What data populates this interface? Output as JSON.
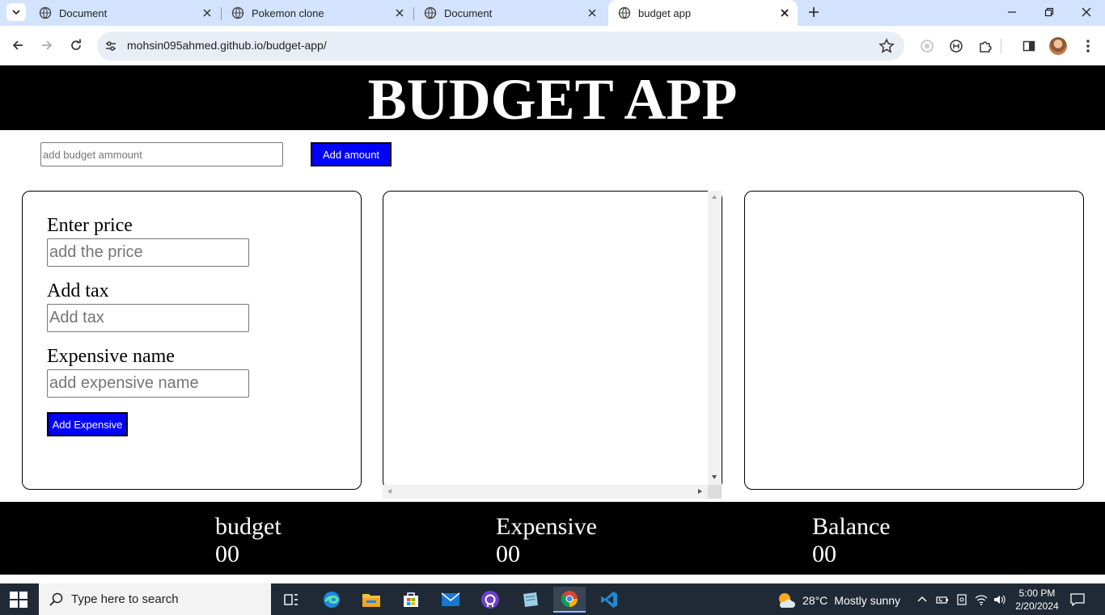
{
  "browser": {
    "tabs": [
      {
        "title": "Document",
        "active": false
      },
      {
        "title": "Pokemon clone",
        "active": false
      },
      {
        "title": "Document",
        "active": false
      },
      {
        "title": "budget app",
        "active": true
      }
    ],
    "url": "mohsin095ahmed.github.io/budget-app/"
  },
  "app": {
    "header_title": "BUDGET APP",
    "budget_input_placeholder": "add budget ammount",
    "add_amount_label": "Add amount",
    "form": {
      "price_label": "Enter price",
      "price_placeholder": "add the price",
      "tax_label": "Add tax",
      "tax_placeholder": "Add tax",
      "name_label": "Expensive name",
      "name_placeholder": "add expensive name",
      "add_expense_label": "Add Expensive"
    },
    "footer": {
      "budget_label": "budget",
      "budget_value": "00",
      "expense_label": "Expensive",
      "expense_value": "00",
      "balance_label": "Balance",
      "balance_value": "00"
    },
    "colors": {
      "accent": "#0000ff",
      "bar": "#000000"
    }
  },
  "taskbar": {
    "search_placeholder": "Type here to search",
    "weather_temp": "28°C",
    "weather_desc": "Mostly sunny",
    "time": "5:00 PM",
    "date": "2/20/2024"
  }
}
